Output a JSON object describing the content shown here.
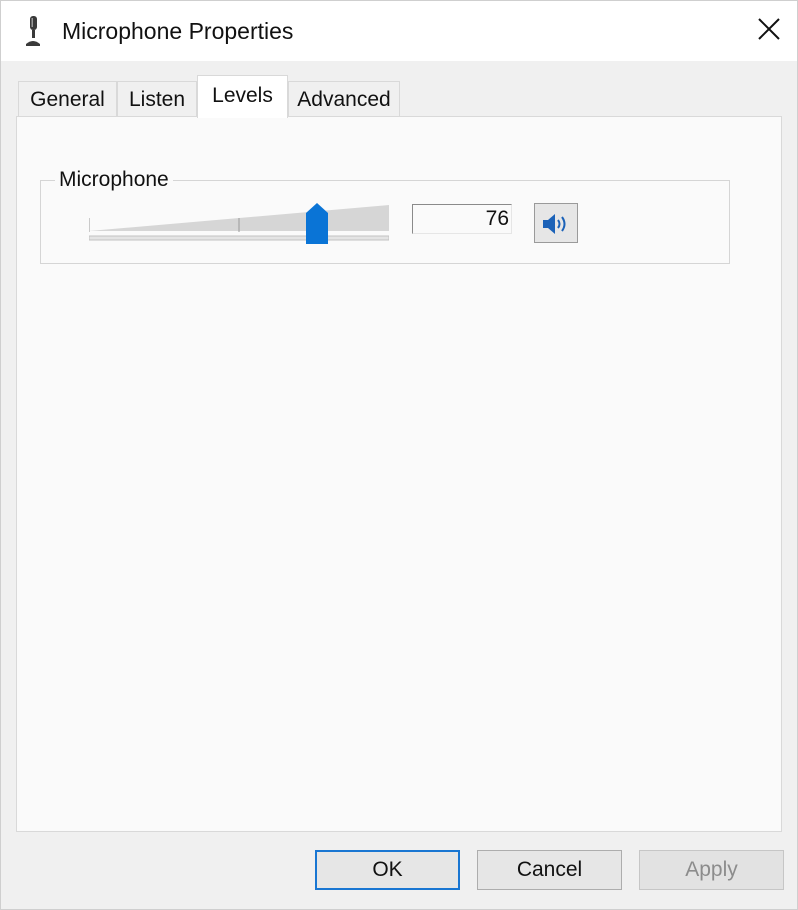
{
  "window": {
    "title": "Microphone Properties",
    "icon": "microphone-icon"
  },
  "tabs": [
    {
      "label": "General",
      "active": false
    },
    {
      "label": "Listen",
      "active": false
    },
    {
      "label": "Levels",
      "active": true
    },
    {
      "label": "Advanced",
      "active": false
    }
  ],
  "levels": {
    "group_label": "Microphone",
    "slider_value": 76,
    "slider_max": 100,
    "volume_text": "76",
    "mute_icon": "speaker-volume-icon"
  },
  "buttons": {
    "ok": "OK",
    "cancel": "Cancel",
    "apply": "Apply"
  },
  "colors": {
    "accent": "#1976d2",
    "slider_thumb": "#0a74d6",
    "disabled_text": "#8c8c8c"
  }
}
